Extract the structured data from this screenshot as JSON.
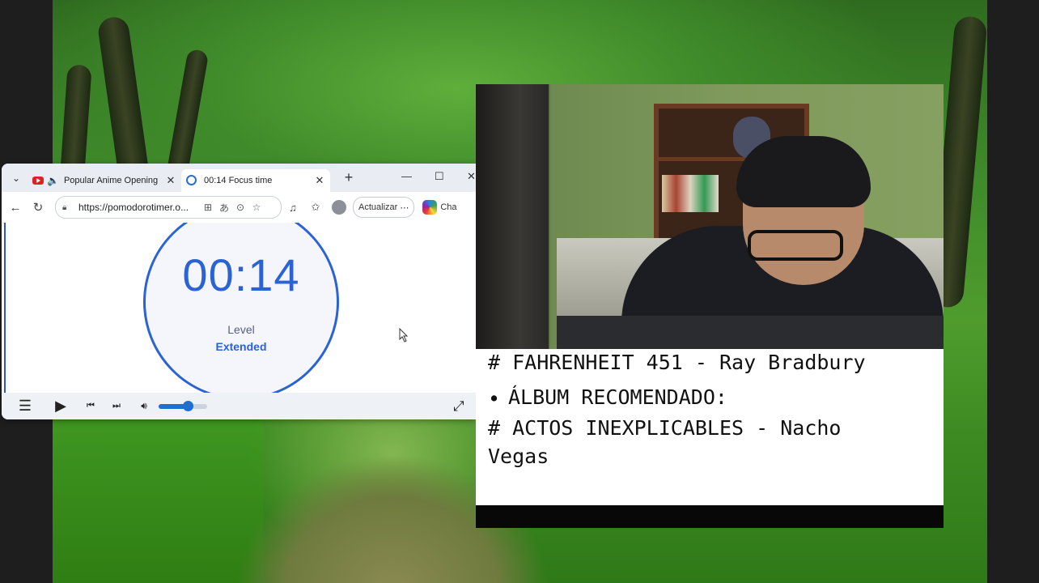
{
  "browser": {
    "tabs": [
      {
        "title": "Popular Anime Opening",
        "active": false,
        "icon": "youtube-icon",
        "audio": true
      },
      {
        "title": "00:14 Focus time",
        "active": true,
        "icon": "circle-icon"
      }
    ],
    "new_tab_symbol": "+",
    "url": "https://pomodorotimer.o...",
    "update_button": "Actualizar",
    "copilot_label": "Cha"
  },
  "timer": {
    "display": "00:14",
    "level_label": "Level",
    "level_value": "Extended",
    "accent_color": "#2b62d4"
  },
  "player": {
    "volume_level": 0.6
  },
  "caption": {
    "line1": "# FAHRENHEIT 451 - Ray Bradbury",
    "bullet": "•",
    "line2": "ÁLBUM RECOMENDADO:",
    "line3": "# ACTOS INEXPLICABLES - Nacho",
    "line4": "Vegas"
  }
}
